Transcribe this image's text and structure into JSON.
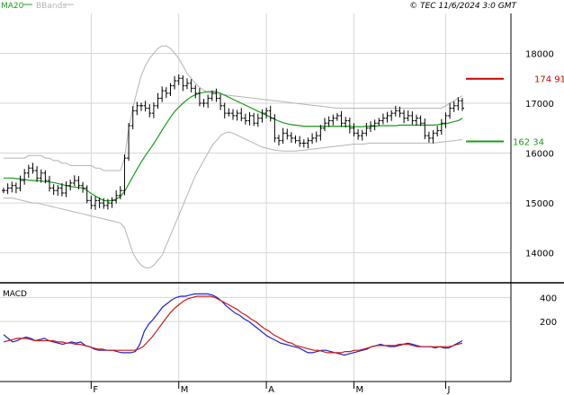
{
  "header": {
    "legend": [
      {
        "label": "MA20",
        "color": "#1a9c1a"
      },
      {
        "label": "BBands",
        "color": "#b4b4b4"
      }
    ],
    "credit": "© TEC 11/6/2024 3:0 GMT"
  },
  "colors": {
    "price": "#000000",
    "ma": "#1a9c1a",
    "bbands": "#b4b4b4",
    "grid": "#d6d6d6",
    "axis": "#000000",
    "macd": "#2222cc",
    "signal": "#cc1a1a",
    "resistance": "#cc0000",
    "support": "#1a9c1a"
  },
  "chart_data": [
    {
      "type": "ohlc",
      "panel": "price",
      "ylim": [
        13400,
        18800
      ],
      "yticks": [
        {
          "value": 14000,
          "label": "14000"
        },
        {
          "value": 15000,
          "label": "15000"
        },
        {
          "value": 16000,
          "label": "16000"
        },
        {
          "value": 17000,
          "label": "17000"
        },
        {
          "value": 18000,
          "label": "18000"
        }
      ],
      "x_months": [
        {
          "index": 21,
          "label": "F"
        },
        {
          "index": 42,
          "label": "M"
        },
        {
          "index": 63,
          "label": "A"
        },
        {
          "index": 84,
          "label": "M"
        },
        {
          "index": 106,
          "label": "J"
        }
      ],
      "n_bars": 111,
      "bars_close": [
        15250,
        15300,
        15350,
        15300,
        15450,
        15600,
        15700,
        15650,
        15500,
        15600,
        15450,
        15300,
        15250,
        15300,
        15200,
        15350,
        15400,
        15450,
        15350,
        15300,
        15050,
        14950,
        15050,
        15000,
        14950,
        15000,
        15050,
        15150,
        15250,
        15900,
        16550,
        16850,
        16950,
        16950,
        16900,
        16800,
        16950,
        17100,
        17250,
        17200,
        17350,
        17450,
        17500,
        17350,
        17400,
        17300,
        17200,
        17000,
        17000,
        17100,
        17200,
        17100,
        16950,
        16800,
        16800,
        16750,
        16800,
        16700,
        16650,
        16750,
        16600,
        16700,
        16800,
        16850,
        16700,
        16300,
        16250,
        16400,
        16350,
        16300,
        16250,
        16200,
        16200,
        16250,
        16300,
        16350,
        16500,
        16600,
        16650,
        16700,
        16750,
        16600,
        16650,
        16500,
        16400,
        16350,
        16400,
        16500,
        16550,
        16600,
        16650,
        16700,
        16750,
        16800,
        16850,
        16800,
        16700,
        16750,
        16650,
        16700,
        16600,
        16350,
        16300,
        16400,
        16450,
        16600,
        16750,
        16900,
        16950,
        17050,
        16900
      ],
      "bars_half_range": 110,
      "ma20": [
        15500,
        15500,
        15500,
        15490,
        15480,
        15470,
        15460,
        15450,
        15450,
        15440,
        15430,
        15420,
        15410,
        15390,
        15370,
        15350,
        15330,
        15320,
        15310,
        15300,
        15250,
        15190,
        15140,
        15090,
        15050,
        15040,
        15050,
        15080,
        15130,
        15230,
        15380,
        15530,
        15680,
        15820,
        15950,
        16070,
        16190,
        16320,
        16460,
        16590,
        16720,
        16830,
        16920,
        17000,
        17070,
        17130,
        17170,
        17200,
        17220,
        17230,
        17240,
        17230,
        17200,
        17160,
        17120,
        17080,
        17040,
        17000,
        16960,
        16920,
        16880,
        16840,
        16800,
        16760,
        16720,
        16680,
        16640,
        16610,
        16590,
        16570,
        16560,
        16550,
        16540,
        16540,
        16540,
        16540,
        16540,
        16540,
        16540,
        16540,
        16540,
        16540,
        16540,
        16540,
        16530,
        16530,
        16530,
        16540,
        16540,
        16540,
        16550,
        16550,
        16550,
        16550,
        16550,
        16560,
        16560,
        16560,
        16560,
        16560,
        16560,
        16560,
        16560,
        16560,
        16570,
        16580,
        16590,
        16610,
        16630,
        16650,
        16700
      ],
      "bb_upper": [
        15900,
        15900,
        15900,
        15900,
        15900,
        15900,
        15950,
        15950,
        15950,
        15950,
        15900,
        15900,
        15850,
        15850,
        15800,
        15800,
        15750,
        15750,
        15750,
        15750,
        15750,
        15750,
        15700,
        15700,
        15650,
        15650,
        15650,
        15650,
        15650,
        15900,
        16500,
        16900,
        17250,
        17550,
        17750,
        17900,
        18000,
        18100,
        18150,
        18150,
        18100,
        18000,
        17900,
        17750,
        17600,
        17500,
        17400,
        17320,
        17260,
        17220,
        17200,
        17190,
        17180,
        17170,
        17160,
        17150,
        17140,
        17130,
        17120,
        17110,
        17100,
        17090,
        17080,
        17070,
        17060,
        17050,
        17040,
        17030,
        17020,
        17010,
        17000,
        16990,
        16980,
        16970,
        16960,
        16950,
        16940,
        16930,
        16920,
        16910,
        16900,
        16900,
        16900,
        16900,
        16900,
        16900,
        16900,
        16900,
        16900,
        16900,
        16900,
        16900,
        16900,
        16900,
        16900,
        16900,
        16900,
        16900,
        16900,
        16900,
        16900,
        16900,
        16900,
        16900,
        16900,
        16900,
        16950,
        17000,
        17050,
        17100,
        17150
      ],
      "bb_lower": [
        15100,
        15100,
        15100,
        15080,
        15060,
        15040,
        15020,
        15000,
        15000,
        14980,
        14960,
        14940,
        14920,
        14900,
        14880,
        14860,
        14840,
        14820,
        14800,
        14780,
        14760,
        14740,
        14720,
        14700,
        14680,
        14660,
        14640,
        14620,
        14600,
        14500,
        14250,
        14000,
        13850,
        13750,
        13700,
        13700,
        13750,
        13850,
        13950,
        14150,
        14350,
        14550,
        14750,
        14950,
        15150,
        15350,
        15550,
        15700,
        15850,
        16000,
        16150,
        16250,
        16350,
        16400,
        16420,
        16400,
        16360,
        16320,
        16280,
        16240,
        16200,
        16160,
        16120,
        16100,
        16080,
        16060,
        16050,
        16040,
        16040,
        16040,
        16040,
        16050,
        16060,
        16070,
        16080,
        16090,
        16100,
        16110,
        16120,
        16130,
        16140,
        16150,
        16160,
        16170,
        16180,
        16180,
        16180,
        16190,
        16200,
        16200,
        16200,
        16200,
        16200,
        16200,
        16200,
        16200,
        16200,
        16200,
        16200,
        16200,
        16200,
        16200,
        16200,
        16200,
        16210,
        16220,
        16230,
        16240,
        16250,
        16260,
        16270
      ],
      "annotations": [
        {
          "name": "resistance",
          "value": 17491,
          "label": "174 91"
        },
        {
          "name": "support",
          "value": 16234,
          "label": "162 34"
        }
      ]
    },
    {
      "type": "line",
      "panel": "macd",
      "title": "MACD",
      "ylim": [
        -300,
        500
      ],
      "yticks": [
        {
          "value": 200,
          "label": "200"
        },
        {
          "value": 400,
          "label": "400"
        }
      ],
      "series": [
        {
          "key": "macd",
          "values": [
            90,
            60,
            30,
            40,
            60,
            70,
            60,
            40,
            50,
            60,
            40,
            30,
            20,
            10,
            20,
            30,
            20,
            30,
            0,
            -10,
            -30,
            -40,
            -40,
            -40,
            -40,
            -50,
            -60,
            -60,
            -60,
            -50,
            10,
            120,
            180,
            220,
            270,
            320,
            350,
            380,
            400,
            410,
            410,
            420,
            430,
            430,
            430,
            430,
            420,
            400,
            370,
            330,
            300,
            270,
            250,
            220,
            200,
            170,
            140,
            110,
            80,
            60,
            40,
            20,
            10,
            0,
            -10,
            -20,
            -40,
            -60,
            -60,
            -50,
            -40,
            -40,
            -50,
            -60,
            -70,
            -80,
            -70,
            -60,
            -50,
            -40,
            -30,
            -10,
            0,
            10,
            0,
            -10,
            -10,
            0,
            10,
            20,
            10,
            0,
            -10,
            -10,
            -10,
            -20,
            -10,
            -20,
            -20,
            0,
            20,
            40
          ]
        },
        {
          "key": "signal",
          "values": [
            30,
            40,
            50,
            60,
            60,
            60,
            50,
            40,
            40,
            40,
            40,
            40,
            30,
            30,
            20,
            20,
            10,
            10,
            0,
            -10,
            -20,
            -30,
            -30,
            -40,
            -40,
            -40,
            -40,
            -40,
            -40,
            -40,
            -30,
            -10,
            30,
            70,
            120,
            170,
            220,
            270,
            310,
            340,
            370,
            390,
            400,
            410,
            410,
            410,
            410,
            400,
            380,
            360,
            340,
            320,
            300,
            270,
            250,
            220,
            200,
            170,
            140,
            120,
            90,
            70,
            50,
            30,
            20,
            0,
            -10,
            -20,
            -30,
            -40,
            -40,
            -50,
            -60,
            -60,
            -60,
            -60,
            -50,
            -50,
            -40,
            -40,
            -30,
            -20,
            -10,
            0,
            0,
            0,
            0,
            0,
            10,
            10,
            10,
            0,
            -10,
            -10,
            -10,
            -10,
            -10,
            -10,
            -10,
            -10,
            0,
            10,
            20
          ]
        }
      ]
    }
  ]
}
